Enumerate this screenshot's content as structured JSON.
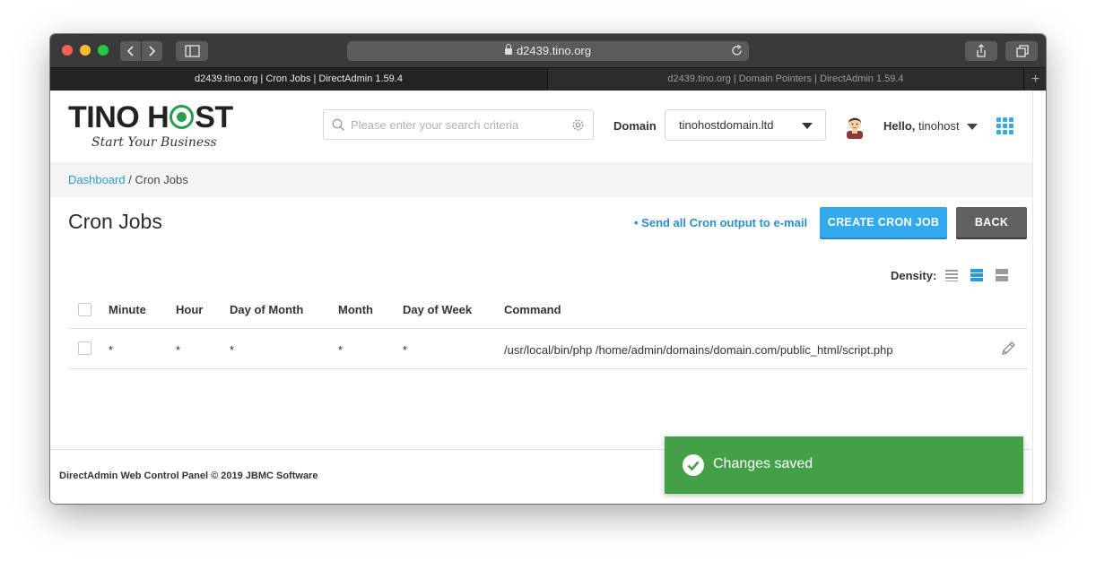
{
  "browser": {
    "url": "d2439.tino.org",
    "tabs": [
      {
        "label": "d2439.tino.org | Cron Jobs | DirectAdmin 1.59.4",
        "active": true
      },
      {
        "label": "d2439.tino.org | Domain Pointers | DirectAdmin 1.59.4",
        "active": false
      }
    ],
    "new_tab": "+"
  },
  "header": {
    "logo_left": "TINO",
    "logo_right": "HST",
    "logo_tagline": "Start Your Business",
    "search_placeholder": "Please enter your search criteria",
    "domain_label": "Domain",
    "domain_value": "tinohostdomain.ltd",
    "hello_prefix": "Hello,",
    "username": "tinohost"
  },
  "breadcrumb": {
    "root": "Dashboard",
    "separator": " / ",
    "current": "Cron Jobs"
  },
  "main": {
    "title": "Cron Jobs",
    "send_link": "• Send all Cron output to e-mail",
    "create_button": "CREATE CRON JOB",
    "back_button": "BACK",
    "density_label": "Density:",
    "density_selected": "medium"
  },
  "table": {
    "columns": [
      "Minute",
      "Hour",
      "Day of Month",
      "Month",
      "Day of Week",
      "Command"
    ],
    "rows": [
      {
        "minute": "*",
        "hour": "*",
        "day_of_month": "*",
        "month": "*",
        "day_of_week": "*",
        "command": "/usr/local/bin/php /home/admin/domains/domain.com/public_html/script.php"
      }
    ]
  },
  "footer": {
    "text": "DirectAdmin Web Control Panel © 2019 JBMC Software"
  },
  "toast": {
    "message": "Changes saved"
  },
  "colors": {
    "accent": "#33aaeb",
    "link": "#2b9bd7",
    "toast_green": "#43a047",
    "back_button": "#616161",
    "logo_green": "#2a9d4a"
  }
}
